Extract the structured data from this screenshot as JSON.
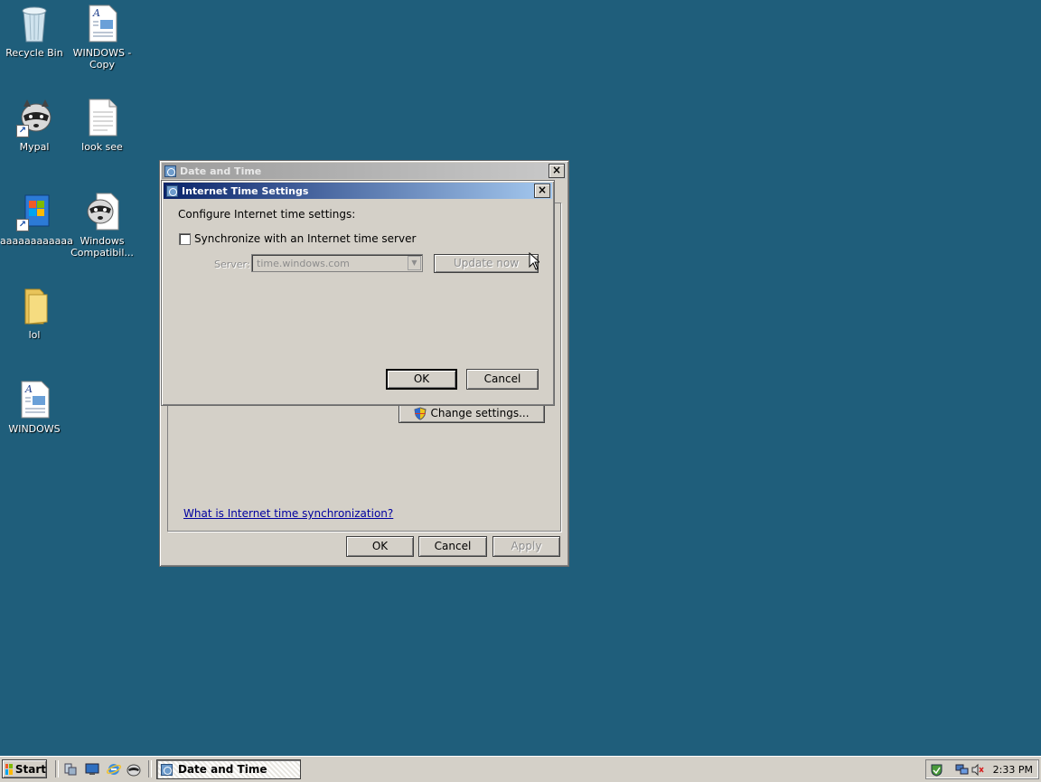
{
  "desktop": {
    "icons": [
      {
        "label_line1": "Recycle Bin",
        "label_line2": ""
      },
      {
        "label_line1": "WINDOWS -",
        "label_line2": "Copy"
      },
      {
        "label_line1": "Mypal",
        "label_line2": ""
      },
      {
        "label_line1": "look see",
        "label_line2": ""
      },
      {
        "label_line1": "aaaaaaaaaaaa",
        "label_line2": ""
      },
      {
        "label_line1": "Windows",
        "label_line2": "Compatibil..."
      },
      {
        "label_line1": "lol",
        "label_line2": ""
      },
      {
        "label_line1": "WINDOWS",
        "label_line2": ""
      }
    ]
  },
  "date_time_window": {
    "title": "Date and Time",
    "change_settings_label": "Change settings...",
    "help_link": "What is Internet time synchronization?",
    "ok_label": "OK",
    "cancel_label": "Cancel",
    "apply_label": "Apply"
  },
  "internet_time_dialog": {
    "title": "Internet Time Settings",
    "heading": "Configure Internet time settings:",
    "sync_label": "Synchronize with an Internet time server",
    "sync_checked": false,
    "server_label": "Server:",
    "server_value": "time.windows.com",
    "update_now_label": "Update now",
    "ok_label": "OK",
    "cancel_label": "Cancel"
  },
  "taskbar": {
    "start_label": "Start",
    "task_label": "Date and Time",
    "clock": "2:33 PM"
  },
  "colors": {
    "desktop": "#1f5e7b",
    "face": "#d4d0c8",
    "active_title_start": "#0a246a",
    "active_title_end": "#a6caf0"
  }
}
